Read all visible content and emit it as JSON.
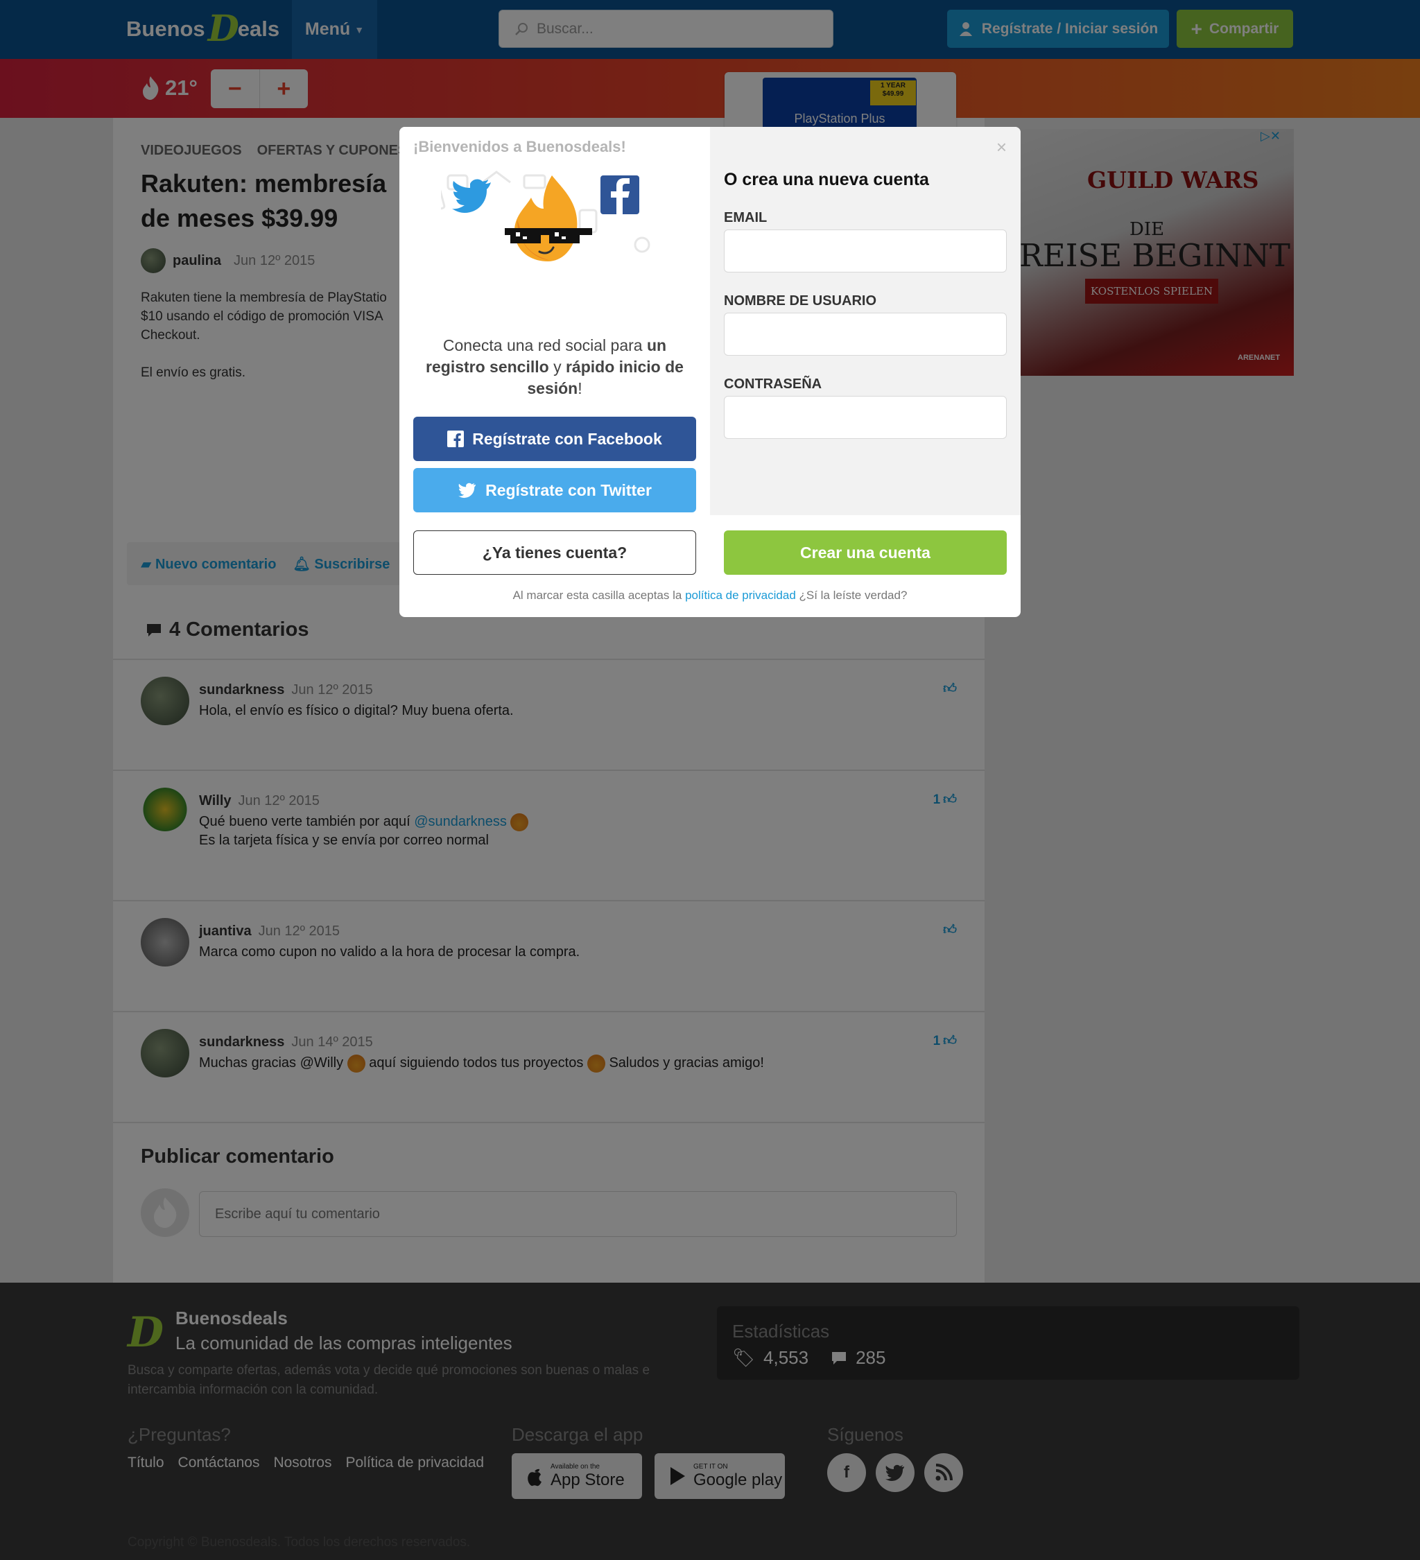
{
  "header": {
    "logo_part1": "Buenos",
    "logo_part2": "D",
    "logo_part3": "eals",
    "menu_label": "Menú",
    "search_placeholder": "Buscar...",
    "login_label": "Regístrate / Iniciar sesión",
    "share_label": "Compartir"
  },
  "temperature": {
    "value": "21°",
    "minus": "−",
    "plus": "+"
  },
  "deal": {
    "categories": [
      "VIDEOJUEGOS",
      "OFERTAS Y CUPONES"
    ],
    "title": "Rakuten: membresía de meses $39.99",
    "author": "paulina",
    "date": "Jun 12º 2015",
    "body_line1": "Rakuten tiene la membresía de PlayStatio",
    "body_line2": "$10 usando el código de promoción VISA",
    "body_line3": "Checkout.",
    "body_line4": "El envío es gratis.",
    "image_caption": "PlayStation Plus",
    "image_tag": "1 YEAR",
    "image_price": "$49.99"
  },
  "actions": {
    "new_comment": "Nuevo comentario",
    "subscribe": "Suscribirse"
  },
  "comments": {
    "header": "4 Comentarios",
    "items": [
      {
        "user": "sundarkness",
        "date": "Jun 12º 2015",
        "text": "Hola, el envío es físico o digital? Muy buena oferta.",
        "likes": ""
      },
      {
        "user": "Willy",
        "date": "Jun 12º 2015",
        "text1": "Qué bueno verte también por aquí",
        "mention": "@sundarkness",
        "text2": "Es la tarjeta física y se envía por correo normal",
        "likes": "1"
      },
      {
        "user": "juantiva",
        "date": "Jun 12º 2015",
        "text": "Marca como cupon no valido a la hora de procesar la compra.",
        "likes": ""
      },
      {
        "user": "sundarkness",
        "date": "Jun 14º 2015",
        "text1": "Muchas gracias @Willy",
        "text2": "aquí siguiendo todos tus proyectos",
        "text3": "Saludos y gracias amigo!",
        "likes": "1"
      }
    ]
  },
  "post": {
    "header": "Publicar comentario",
    "placeholder": "Escribe aquí tu comentario"
  },
  "ad": {
    "title": "GUILD WARS",
    "line1": "DIE",
    "line2": "REISE BEGINNT",
    "button": "KOSTENLOS SPIELEN",
    "brand": "ARENANET"
  },
  "footer": {
    "name": "Buenosdeals",
    "tagline": "La comunidad de las compras inteligentes",
    "description": "Busca y comparte ofertas, además vota y decide qué promociones son buenas o malas e intercambia información con la comunidad.",
    "stats_title": "Estadísticas",
    "stats_deals": "4,553",
    "stats_comments": "285",
    "questions_title": "¿Preguntas?",
    "links": [
      "Título",
      "Contáctanos",
      "Nosotros",
      "Política de privacidad"
    ],
    "app_title": "Descarga el app",
    "appstore_small": "Available on the",
    "appstore_big": "App Store",
    "gplay_small": "GET IT ON",
    "gplay_big": "Google play",
    "follow_title": "Síguenos",
    "copyright": "Copyright © Buenosdeals. Todos los derechos reservados."
  },
  "modal": {
    "welcome": "¡Bienvenidos a Buenosdeals!",
    "close": "×",
    "social_text_a": "Conecta una red social para ",
    "social_text_b": "un registro sencillo",
    "social_text_c": " y ",
    "social_text_d": "rápido inicio de sesión",
    "social_text_e": "!",
    "facebook_button": "Regístrate con Facebook",
    "twitter_button": "Regístrate con Twitter",
    "have_account_button": "¿Ya tienes cuenta?",
    "create_header": "O crea una nueva cuenta",
    "email_label": "EMAIL",
    "username_label": "NOMBRE DE USUARIO",
    "password_label": "CONTRASEÑA",
    "create_button": "Crear una cuenta",
    "privacy_a": "Al marcar esta casilla aceptas la ",
    "privacy_link": "política de privacidad",
    "privacy_b": " ¿Sí la leíste verdad?"
  },
  "colors": {
    "header_blue": "#0b5390",
    "accent_blue": "#1a9ad6",
    "green": "#8dc63f",
    "facebook": "#2f5597",
    "twitter": "#4aabec"
  }
}
